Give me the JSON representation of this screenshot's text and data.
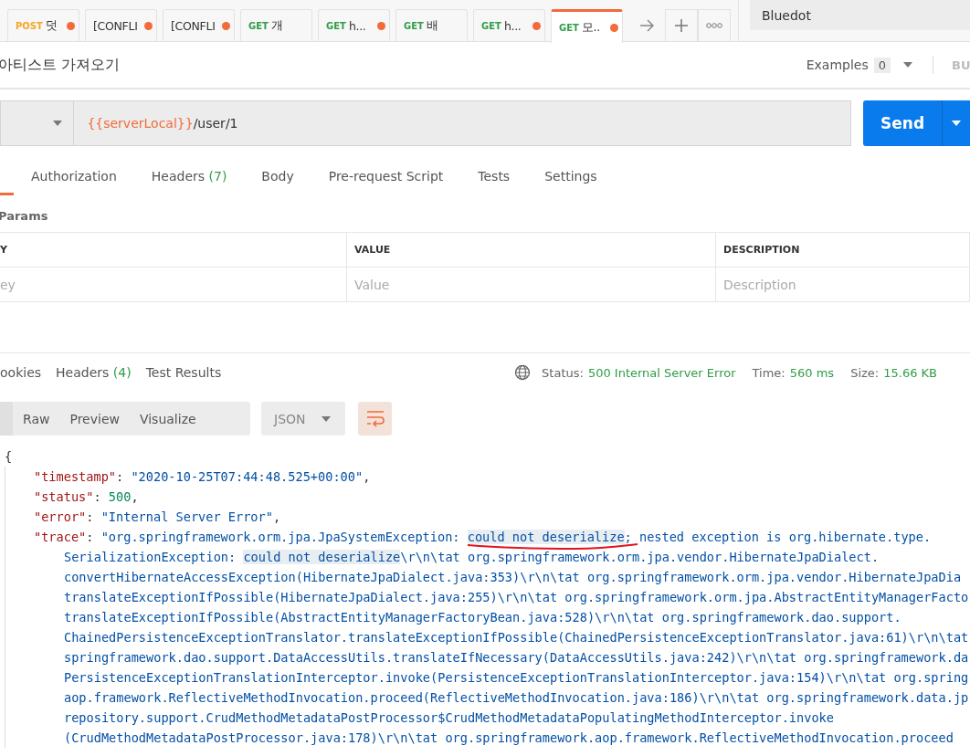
{
  "tabs": [
    {
      "method": "POST",
      "title": "덧",
      "unsaved": true,
      "selected": false
    },
    {
      "title": "[CONFLI",
      "unsaved": true,
      "selected": false
    },
    {
      "title": "[CONFLI",
      "unsaved": true,
      "selected": false
    },
    {
      "method": "GET",
      "title": "개",
      "unsaved": false,
      "selected": false
    },
    {
      "method": "GET",
      "title": "h...",
      "unsaved": true,
      "selected": false
    },
    {
      "method": "GET",
      "title": "배",
      "unsaved": false,
      "selected": false
    },
    {
      "method": "GET",
      "title": "h...",
      "unsaved": true,
      "selected": false
    },
    {
      "method": "GET",
      "title": "모..",
      "unsaved": true,
      "selected": true
    }
  ],
  "environment": "Bluedot",
  "request_name": "아티스트 가져오기",
  "examples": {
    "label": "Examples",
    "count": "0"
  },
  "build_label": "BU",
  "url": {
    "variable": "{{serverLocal}}",
    "path": "/user/1"
  },
  "send_button": "Send",
  "request_tabs": [
    {
      "selected": true
    },
    {
      "label": "Authorization",
      "selected": false
    },
    {
      "label": "Headers",
      "count": "(7)",
      "selected": false
    },
    {
      "label": "Body",
      "selected": false
    },
    {
      "label": "Pre-request Script",
      "selected": false
    },
    {
      "label": "Tests",
      "selected": false
    },
    {
      "label": "Settings",
      "selected": false
    }
  ],
  "params": {
    "title": "Params",
    "columns": [
      "Y",
      "VALUE",
      "DESCRIPTION"
    ],
    "placeholders": [
      "ey",
      "Value",
      "Description"
    ]
  },
  "response_tabs": [
    {
      "label": "ookies",
      "selected": false
    },
    {
      "label": "Headers",
      "count": "(4)",
      "selected": false
    },
    {
      "label": "Test Results",
      "selected": false
    }
  ],
  "status": {
    "label": "Status:",
    "value": "500 Internal Server Error"
  },
  "time": {
    "label": "Time:",
    "value": "560 ms"
  },
  "size": {
    "label": "Size:",
    "value": "15.66 KB"
  },
  "view_modes": [
    {
      "selected": true
    },
    {
      "label": "Raw",
      "selected": false
    },
    {
      "label": "Preview",
      "selected": false
    },
    {
      "label": "Visualize",
      "selected": false
    }
  ],
  "format": "JSON",
  "wrap_on": true,
  "body_lines": [
    {
      "kind": "open",
      "tokens": [
        {
          "kind": "punct",
          "text": "{"
        }
      ]
    },
    {
      "kind": "member",
      "tokens": [
        {
          "kind": "key",
          "text": "\"timestamp\""
        },
        {
          "kind": "punct",
          "text": ": "
        },
        {
          "kind": "string",
          "text": "\"2020-10-25T07:44:48.525+00:00\""
        },
        {
          "kind": "punct",
          "text": ","
        }
      ]
    },
    {
      "kind": "member",
      "tokens": [
        {
          "kind": "key",
          "text": "\"status\""
        },
        {
          "kind": "punct",
          "text": ": "
        },
        {
          "kind": "number",
          "text": "500"
        },
        {
          "kind": "punct",
          "text": ","
        }
      ]
    },
    {
      "kind": "member",
      "tokens": [
        {
          "kind": "key",
          "text": "\"error\""
        },
        {
          "kind": "punct",
          "text": ": "
        },
        {
          "kind": "string",
          "text": "\"Internal Server Error\""
        },
        {
          "kind": "punct",
          "text": ","
        }
      ]
    },
    {
      "kind": "member",
      "tokens": [
        {
          "kind": "key",
          "text": "\"trace\""
        },
        {
          "kind": "punct",
          "text": ": "
        },
        {
          "kind": "string",
          "text": "\"org.springframework.orm.jpa.JpaSystemException: "
        },
        {
          "kind": "match",
          "text": "could not deserialize",
          "underlined": true
        },
        {
          "kind": "string",
          "text": "; nested exception is org.hibernate.type."
        }
      ]
    },
    {
      "kind": "continuation",
      "tokens": [
        {
          "kind": "string",
          "text": "SerializationException: "
        },
        {
          "kind": "match",
          "text": "could not deserialize",
          "underlined": false
        },
        {
          "kind": "string",
          "text": "\\r\\n\\tat org.springframework.orm.jpa.vendor.HibernateJpaDialect."
        }
      ]
    },
    {
      "kind": "continuation",
      "tokens": [
        {
          "kind": "string",
          "text": "convertHibernateAccessException(HibernateJpaDialect.java:353)\\r\\n\\tat org.springframework.orm.jpa.vendor.HibernateJpaDia"
        }
      ]
    },
    {
      "kind": "continuation",
      "tokens": [
        {
          "kind": "string",
          "text": "translateExceptionIfPossible(HibernateJpaDialect.java:255)\\r\\n\\tat org.springframework.orm.jpa.AbstractEntityManagerFacto"
        }
      ]
    },
    {
      "kind": "continuation",
      "tokens": [
        {
          "kind": "string",
          "text": "translateExceptionIfPossible(AbstractEntityManagerFactoryBean.java:528)\\r\\n\\tat org.springframework.dao.support."
        }
      ]
    },
    {
      "kind": "continuation",
      "tokens": [
        {
          "kind": "string",
          "text": "ChainedPersistenceExceptionTranslator.translateExceptionIfPossible(ChainedPersistenceExceptionTranslator.java:61)\\r\\n\\tat"
        }
      ]
    },
    {
      "kind": "continuation",
      "tokens": [
        {
          "kind": "string",
          "text": "springframework.dao.support.DataAccessUtils.translateIfNecessary(DataAccessUtils.java:242)\\r\\n\\tat org.springframework.da"
        }
      ]
    },
    {
      "kind": "continuation",
      "tokens": [
        {
          "kind": "string",
          "text": "PersistenceExceptionTranslationInterceptor.invoke(PersistenceExceptionTranslationInterceptor.java:154)\\r\\n\\tat org.spring"
        }
      ]
    },
    {
      "kind": "continuation",
      "tokens": [
        {
          "kind": "string",
          "text": "aop.framework.ReflectiveMethodInvocation.proceed(ReflectiveMethodInvocation.java:186)\\r\\n\\tat org.springframework.data.jp"
        }
      ]
    },
    {
      "kind": "continuation",
      "tokens": [
        {
          "kind": "string",
          "text": "repository.support.CrudMethodMetadataPostProcessor$CrudMethodMetadataPopulatingMethodInterceptor.invoke"
        }
      ]
    },
    {
      "kind": "continuation",
      "tokens": [
        {
          "kind": "string",
          "text": "(CrudMethodMetadataPostProcessor.java:178)\\r\\n\\tat org.springframework.aop.framework.ReflectiveMethodInvocation.proceed"
        }
      ]
    }
  ]
}
